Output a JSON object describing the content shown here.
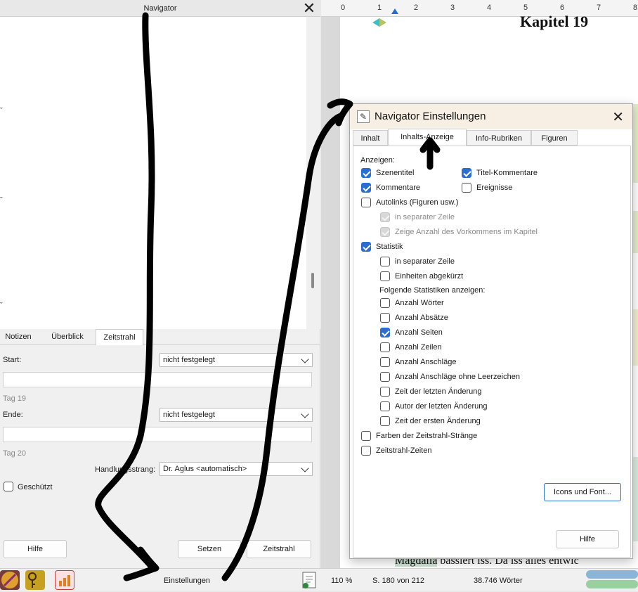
{
  "navigator": {
    "title": "Navigator",
    "tabs": [
      "Notizen",
      "Überblick",
      "Zeitstrahl"
    ],
    "start_label": "Start:",
    "start_value": "nicht festgelegt",
    "start_day": "Tag 19",
    "end_label": "Ende:",
    "end_value": "nicht festgelegt",
    "end_day": "Tag 20",
    "strand_label": "Handlungsstrang:",
    "strand_value": "Dr. Aglus <automatisch>",
    "protected_label": "Geschützt",
    "buttons": {
      "help": "Hilfe",
      "set": "Setzen",
      "timeline": "Zeitstrahl"
    }
  },
  "document": {
    "chapter_title": "Kapitel 19",
    "bottom_line_highlight": "Magdalia",
    "bottom_line_rest": " bassiert iss. Da iss alles entwic",
    "ruler": [
      "0",
      "1",
      "2",
      "3",
      "4",
      "5",
      "6",
      "7",
      "8"
    ]
  },
  "dialog": {
    "title": "Navigator Einstellungen",
    "tabs": [
      "Inhalt",
      "Inhalts-Anzeige",
      "Info-Rubriken",
      "Figuren"
    ],
    "show_label": "Anzeigen:",
    "options": {
      "scene_titles": "Szenentitel",
      "title_comments": "Titel-Kommentare",
      "comments": "Kommentare",
      "events": "Ereignisse",
      "autolinks": "Autolinks (Figuren usw.)",
      "separate_line_1": "in separater Zeile",
      "show_count": "Zeige Anzahl des Vorkommens im Kapitel",
      "statistics": "Statistik",
      "separate_line_2": "in separater Zeile",
      "units_abbrev": "Einheiten abgekürzt",
      "following_stats": "Folgende Statistiken anzeigen:",
      "words": "Anzahl Wörter",
      "paragraphs": "Anzahl Absätze",
      "pages": "Anzahl Seiten",
      "lines": "Anzahl Zeilen",
      "chars": "Anzahl Anschläge",
      "chars_no_space": "Anzahl Anschläge ohne Leerzeichen",
      "last_change_time": "Zeit der letzten Änderung",
      "last_change_author": "Autor der letzten Änderung",
      "first_change_time": "Zeit der ersten Änderung",
      "timeline_colors": "Farben der Zeitstrahl-Stränge",
      "timeline_times": "Zeitstrahl-Zeiten"
    },
    "icons_button": "Icons und Font...",
    "help_button": "Hilfe"
  },
  "statusbar": {
    "settings": "Einstellungen",
    "zoom": "110 %",
    "page": "S. 180 von 212",
    "words": "38.746 Wörter"
  }
}
